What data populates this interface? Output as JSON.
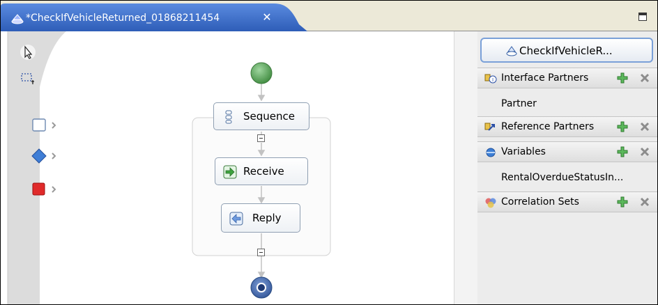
{
  "editor": {
    "tab_title": "*CheckIfVehicleReturned_01868211454",
    "tab_close": "✕",
    "colors": {
      "tab_active": "#3d6fc7",
      "accent": "#7aa0d8",
      "start_node": "#4f9a4f",
      "end_node": "#3a62a8"
    }
  },
  "palette": {
    "items": [
      {
        "name": "selection-tool",
        "icon": "arrow-pointer-icon"
      },
      {
        "name": "marquee-tool",
        "icon": "marquee-select-icon"
      },
      {
        "name": "basic-activities",
        "icon": "white-square-icon"
      },
      {
        "name": "structured-activities",
        "icon": "blue-diamond-icon"
      },
      {
        "name": "faults",
        "icon": "red-square-icon"
      }
    ]
  },
  "canvas": {
    "sequence_label": "Sequence",
    "receive_label": "Receive",
    "reply_label": "Reply"
  },
  "outline": {
    "process_label": "CheckIfVehicleR...",
    "sections": [
      {
        "label": "Interface Partners",
        "items": [
          "Partner"
        ]
      },
      {
        "label": "Reference Partners",
        "items": []
      },
      {
        "label": "Variables",
        "items": [
          "RentalOverdueStatusIn..."
        ]
      },
      {
        "label": "Correlation Sets",
        "items": []
      }
    ]
  }
}
